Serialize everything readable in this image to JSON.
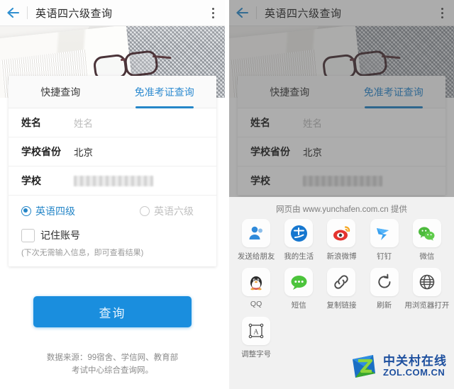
{
  "header": {
    "back_icon": "back-arrow-icon",
    "title": "英语四六级查询",
    "menu_icon": "kebab-menu-icon"
  },
  "hero": {
    "alt": "open book with eyeglasses on knit blanket"
  },
  "tabs": [
    {
      "label": "快捷查询",
      "active": false
    },
    {
      "label": "免准考证查询",
      "active": true
    }
  ],
  "form": {
    "fields": [
      {
        "label": "姓名",
        "value": "",
        "placeholder": "姓名",
        "redacted": false
      },
      {
        "label": "学校省份",
        "value": "北京",
        "placeholder": "",
        "redacted": false
      },
      {
        "label": "学校",
        "value": "",
        "placeholder": "",
        "redacted": true
      }
    ],
    "exam_options": [
      {
        "label": "英语四级",
        "selected": true
      },
      {
        "label": "英语六级",
        "selected": false
      }
    ],
    "remember": {
      "label": "记住账号",
      "checked": false
    },
    "hint": "(下次无需输入信息，即可查看结果)"
  },
  "submit": {
    "label": "查询"
  },
  "footer": {
    "line1": "数据来源：99宿舍、学信网、教育部",
    "line2": "考试中心综合查询网。"
  },
  "share_sheet": {
    "provider_note": "网页由 www.yunchafen.com.cn 提供",
    "items": [
      {
        "label": "发送给朋友",
        "icon": "friend-person-icon"
      },
      {
        "label": "我的生活",
        "icon": "alipay-icon"
      },
      {
        "label": "新浪微博",
        "icon": "weibo-icon"
      },
      {
        "label": "钉钉",
        "icon": "dingtalk-icon"
      },
      {
        "label": "微信",
        "icon": "wechat-icon"
      },
      {
        "label": "QQ",
        "icon": "qq-penguin-icon"
      },
      {
        "label": "短信",
        "icon": "sms-bubble-icon"
      },
      {
        "label": "复制链接",
        "icon": "link-chain-icon"
      },
      {
        "label": "刷新",
        "icon": "refresh-icon"
      },
      {
        "label": "用浏览器打开",
        "icon": "globe-browser-icon"
      },
      {
        "label": "调整字号",
        "icon": "font-size-icon"
      }
    ]
  },
  "watermark": {
    "cn": "中关村在线",
    "en": "ZOL.COM.CN"
  },
  "colors": {
    "accent_blue": "#2586c8",
    "button_blue": "#1a8ede",
    "logo_blue": "#1d4f9e"
  }
}
